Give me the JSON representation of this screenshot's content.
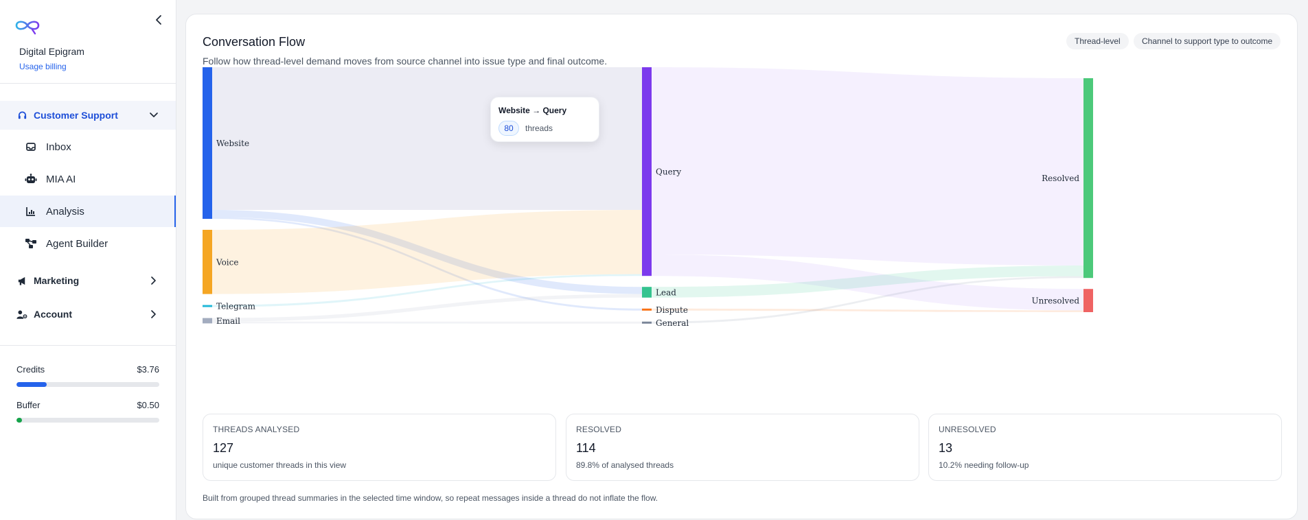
{
  "sidebar": {
    "org_name": "Digital Epigram",
    "billing_link": "Usage billing",
    "sections": [
      {
        "label": "Customer Support",
        "expanded": true,
        "icon": "headset-icon",
        "items": [
          {
            "label": "Inbox",
            "icon": "inbox-icon"
          },
          {
            "label": "MIA AI",
            "icon": "robot-icon"
          },
          {
            "label": "Analysis",
            "icon": "bar-chart-icon",
            "selected": true
          },
          {
            "label": "Agent Builder",
            "icon": "workflow-icon"
          }
        ]
      },
      {
        "label": "Marketing",
        "expanded": false,
        "icon": "megaphone-icon"
      },
      {
        "label": "Account",
        "expanded": false,
        "icon": "user-settings-icon"
      }
    ],
    "credits": {
      "label": "Credits",
      "value": "$3.76",
      "level": 0.21,
      "color": "#2563eb"
    },
    "buffer": {
      "label": "Buffer",
      "value": "$0.50",
      "level": 0.04,
      "color": "#16a34a"
    }
  },
  "main": {
    "title": "Conversation Flow",
    "subtitle": "Follow how thread-level demand moves from source channel into issue type and final outcome.",
    "pills": [
      "Thread-level",
      "Channel to support type to outcome"
    ],
    "tooltip": {
      "title": "Website → Query",
      "value": "80",
      "unit": "threads"
    },
    "stats": [
      {
        "label": "THREADS ANALYSED",
        "value": "127",
        "sub": "unique customer threads in this view"
      },
      {
        "label": "RESOLVED",
        "value": "114",
        "sub": "89.8% of analysed threads"
      },
      {
        "label": "UNRESOLVED",
        "value": "13",
        "sub": "10.2% needing follow-up"
      }
    ],
    "footnote": "Built from grouped thread summaries in the selected time window, so repeat messages inside a thread do not inflate the flow."
  },
  "chart_data": {
    "type": "sankey",
    "nodes": [
      {
        "id": "Website",
        "stage": 0,
        "color": "#2563eb"
      },
      {
        "id": "Voice",
        "stage": 0,
        "color": "#f5a623"
      },
      {
        "id": "Telegram",
        "stage": 0,
        "color": "#22b8d8"
      },
      {
        "id": "Email",
        "stage": 0,
        "color": "#a3acbf"
      },
      {
        "id": "Query",
        "stage": 1,
        "color": "#7c3aed"
      },
      {
        "id": "Lead",
        "stage": 1,
        "color": "#34c38f"
      },
      {
        "id": "Dispute",
        "stage": 1,
        "color": "#f97316"
      },
      {
        "id": "General",
        "stage": 1,
        "color": "#7b8699"
      },
      {
        "id": "Resolved",
        "stage": 2,
        "color": "#4cc97a"
      },
      {
        "id": "Unresolved",
        "stage": 2,
        "color": "#ef6363"
      }
    ],
    "links": [
      {
        "source": "Website",
        "target": "Query",
        "value": 80
      },
      {
        "source": "Website",
        "target": "Lead",
        "value": 4
      },
      {
        "source": "Website",
        "target": "Dispute",
        "value": 1
      },
      {
        "source": "Voice",
        "target": "Query",
        "value": 36
      },
      {
        "source": "Telegram",
        "target": "Query",
        "value": 1
      },
      {
        "source": "Email",
        "target": "Lead",
        "value": 2
      },
      {
        "source": "Email",
        "target": "General",
        "value": 1
      },
      {
        "source": "Query",
        "target": "Resolved",
        "value": 105
      },
      {
        "source": "Query",
        "target": "Unresolved",
        "value": 12
      },
      {
        "source": "Lead",
        "target": "Resolved",
        "value": 6
      },
      {
        "source": "Dispute",
        "target": "Unresolved",
        "value": 1
      },
      {
        "source": "General",
        "target": "Resolved",
        "value": 1
      }
    ]
  }
}
